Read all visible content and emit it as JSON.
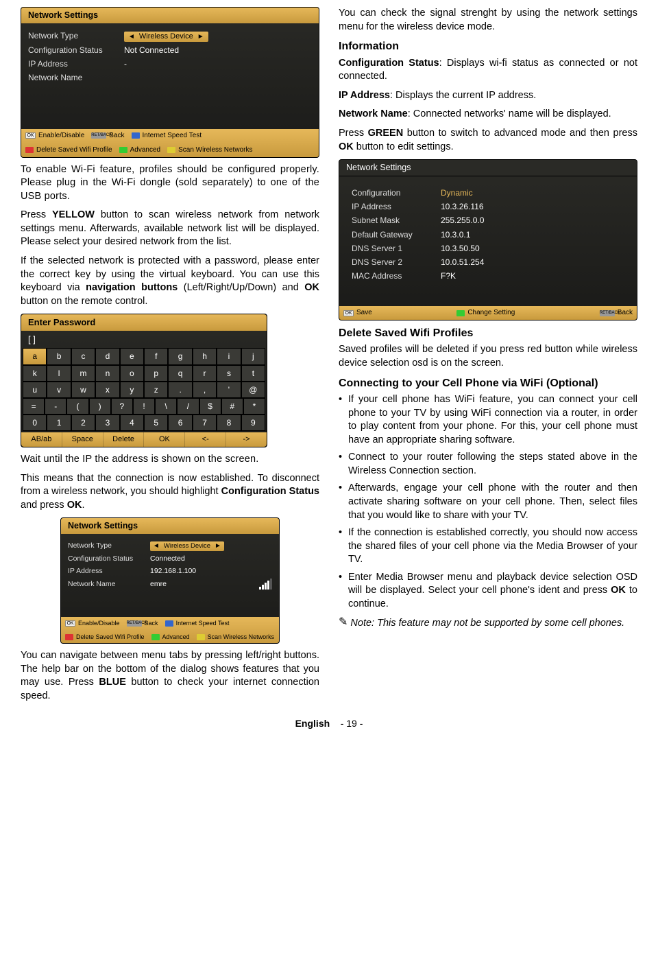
{
  "panel1": {
    "title": "Network Settings",
    "rows": {
      "type_label": "Network Type",
      "type_value": "Wireless Device",
      "cfg_label": "Configuration Status",
      "cfg_value": "Not Connected",
      "ip_label": "IP Address",
      "ip_value": "-",
      "name_label": "Network Name",
      "name_value": ""
    },
    "hints": {
      "h1": "Enable/Disable",
      "h2": "Back",
      "h3": "Internet Speed Test",
      "h4": "Delete Saved Wifi Profile",
      "h5": "Advanced",
      "h6": "Scan Wireless Networks",
      "ok": "OK",
      "ret": "RET/BACK"
    }
  },
  "left_text": {
    "p1a": "To enable Wi-Fi feature, profiles should be configured properly. Please plug in the Wi-Fi dongle (sold separately) to one of the USB ports.",
    "p2a": "Press ",
    "p2b": "YELLOW",
    "p2c": " button to scan wireless network from network settings menu. Afterwards, available network list will be displayed. Please select your desired network from the list.",
    "p3a": "If the selected network is protected with a password, please enter the correct key by using the virtual keyboard. You can use this keyboard via ",
    "p3b": "navigation buttons",
    "p3c": " (Left/Right/Up/Down) and ",
    "p3d": "OK",
    "p3e": " button on the remote control."
  },
  "keyboard": {
    "title": "Enter Password",
    "entry": "[ ]",
    "rows": [
      [
        "a",
        "b",
        "c",
        "d",
        "e",
        "f",
        "g",
        "h",
        "i",
        "j"
      ],
      [
        "k",
        "l",
        "m",
        "n",
        "o",
        "p",
        "q",
        "r",
        "s",
        "t"
      ],
      [
        "u",
        "v",
        "w",
        "x",
        "y",
        "z",
        ".",
        ",",
        "'",
        "@"
      ],
      [
        "=",
        "-",
        "(",
        ")",
        "?",
        "!",
        "\\",
        "/",
        "$",
        "#",
        "*"
      ],
      [
        "0",
        "1",
        "2",
        "3",
        "4",
        "5",
        "6",
        "7",
        "8",
        "9"
      ]
    ],
    "bottom": [
      "AB/ab",
      "Space",
      "Delete",
      "OK",
      "<-",
      "->"
    ]
  },
  "left_after_kb": {
    "p1": "Wait until the IP the address is shown on the screen.",
    "p2a": "This means that the connection is now established. To disconnect from a wireless network, you should highlight ",
    "p2b": "Configuration Status",
    "p2c": " and press ",
    "p2d": "OK",
    "p2e": "."
  },
  "panel2": {
    "title": "Network Settings",
    "rows": {
      "type_label": "Network Type",
      "type_value": "Wireless Device",
      "cfg_label": "Configuration Status",
      "cfg_value": "Connected",
      "ip_label": "IP Address",
      "ip_value": "192.168.1.100",
      "name_label": "Network Name",
      "name_value": "emre"
    }
  },
  "left_bottom": {
    "p1a": "You can navigate between menu tabs by pressing left/right buttons. The help bar on the bottom of the dialog shows features that you may use. Press ",
    "p1b": "BLUE",
    "p1c": " button to check your internet connection speed."
  },
  "right": {
    "intro": "You can check the signal strenght by using the network settings menu for the wireless device mode.",
    "h_info": "Information",
    "cfg_a": "Configuration Status",
    "cfg_b": ": Displays wi-fi status as connected or not connected.",
    "ip_a": "IP Address",
    "ip_b": ": Displays the current IP address.",
    "nn_a": "Network Name",
    "nn_b": ": Connected networks' name will be displayed.",
    "grn_a": "Press ",
    "grn_b": "GREEN",
    "grn_c": " button to switch to advanced mode and then press ",
    "grn_d": "OK",
    "grn_e": " button to edit settings."
  },
  "panel3": {
    "title": "Network Settings",
    "rows": {
      "cfg_label": "Configuration",
      "cfg_value": "Dynamic",
      "ip_label": "IP Address",
      "ip_value": "10.3.26.116",
      "sn_label": "Subnet Mask",
      "sn_value": "255.255.0.0",
      "gw_label": "Default Gateway",
      "gw_value": "10.3.0.1",
      "d1_label": "DNS Server 1",
      "d1_value": "10.3.50.50",
      "d2_label": "DNS Server 2",
      "d2_value": "10.0.51.254",
      "mac_label": "MAC Address",
      "mac_value": "F?K"
    },
    "hints": {
      "h1": "Save",
      "h2": "Change Setting",
      "h3": "Back",
      "ok": "OK",
      "ret": "RET/BACK"
    }
  },
  "right2": {
    "h_del": "Delete Saved Wifi Profiles",
    "del_p": "Saved profiles will be deleted if you press red button while wireless device selection osd is on the screen.",
    "h_cell": "Connecting to your Cell Phone via WiFi (Optional)",
    "b1": "If your cell phone has WiFi feature, you can connect your cell phone to your TV by using WiFi connection via a router, in order to play content from your phone. For this, your cell phone must have an appropriate sharing software.",
    "b2": "Connect to your router following the steps stated above in the Wireless Connection section.",
    "b3": "Afterwards, engage your cell phone with the router and then activate sharing software on your cell phone. Then, select files that you would like to share with your TV.",
    "b4": "If the connection is established correctly, you should now access the shared files of your cell phone via the Media Browser of your TV.",
    "b5a": "Enter Media Browser menu and playback device selection OSD will be displayed. Select your cell phone's ident and press ",
    "b5b": "OK",
    "b5c": " to continue.",
    "note": "Note: This feature may not be supported by some cell phones."
  },
  "footer": {
    "lang": "English",
    "page": "- 19 -"
  }
}
